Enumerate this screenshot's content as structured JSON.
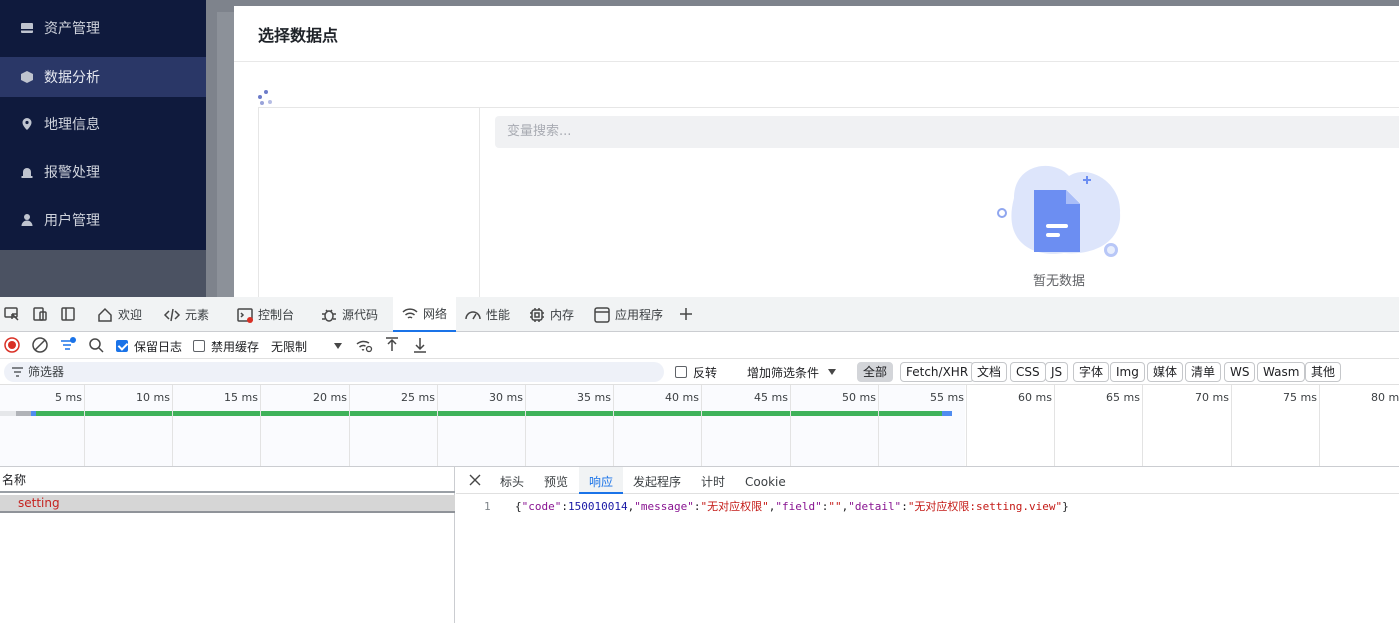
{
  "sidebar": {
    "items": [
      {
        "label": "资产管理",
        "icon": "box-icon",
        "active": false
      },
      {
        "label": "数据分析",
        "icon": "hexagon-icon",
        "active": true
      },
      {
        "label": "地理信息",
        "icon": "map-pin-icon",
        "active": false
      },
      {
        "label": "报警处理",
        "icon": "alarm-icon",
        "active": false
      },
      {
        "label": "用户管理",
        "icon": "user-icon",
        "active": false
      }
    ]
  },
  "dialog": {
    "title": "选择数据点",
    "search_placeholder": "变量搜索...",
    "empty_text": "暂无数据"
  },
  "devtools": {
    "tabs": [
      {
        "label": "欢迎",
        "icon": "home-icon"
      },
      {
        "label": "元素",
        "icon": "code-icon"
      },
      {
        "label": "控制台",
        "icon": "console-icon"
      },
      {
        "label": "源代码",
        "icon": "bug-icon"
      },
      {
        "label": "网络",
        "icon": "wifi-icon",
        "active": true
      },
      {
        "label": "性能",
        "icon": "gauge-icon"
      },
      {
        "label": "内存",
        "icon": "chip-icon"
      },
      {
        "label": "应用程序",
        "icon": "app-icon"
      }
    ],
    "toolbar": {
      "preserve_log": "保留日志",
      "disable_cache": "禁用缓存",
      "throttling": "无限制"
    },
    "filter": {
      "placeholder": "筛选器",
      "invert": "反转",
      "add_filter": "增加筛选条件",
      "types": [
        "全部",
        "Fetch/XHR",
        "文档",
        "CSS",
        "JS",
        "字体",
        "Img",
        "媒体",
        "清单",
        "WS",
        "Wasm",
        "其他"
      ],
      "active_type": "全部"
    },
    "timeline": {
      "ticks": [
        "5 ms",
        "10 ms",
        "15 ms",
        "20 ms",
        "25 ms",
        "30 ms",
        "35 ms",
        "40 ms",
        "45 ms",
        "50 ms",
        "55 ms",
        "60 ms",
        "65 ms",
        "70 ms",
        "75 ms",
        "80 ms"
      ]
    },
    "requests": {
      "header": "名称",
      "rows": [
        {
          "name": "setting"
        }
      ]
    },
    "detail": {
      "tabs": [
        "标头",
        "预览",
        "响应",
        "发起程序",
        "计时",
        "Cookie"
      ],
      "active_tab": "响应",
      "line_number": "1",
      "response": {
        "code_key": "\"code\"",
        "code_val": "150010014",
        "message_key": "\"message\"",
        "message_val": "\"无对应权限\"",
        "field_key": "\"field\"",
        "field_val": "\"\"",
        "detail_key": "\"detail\"",
        "detail_val": "\"无对应权限:setting.view\""
      }
    }
  }
}
